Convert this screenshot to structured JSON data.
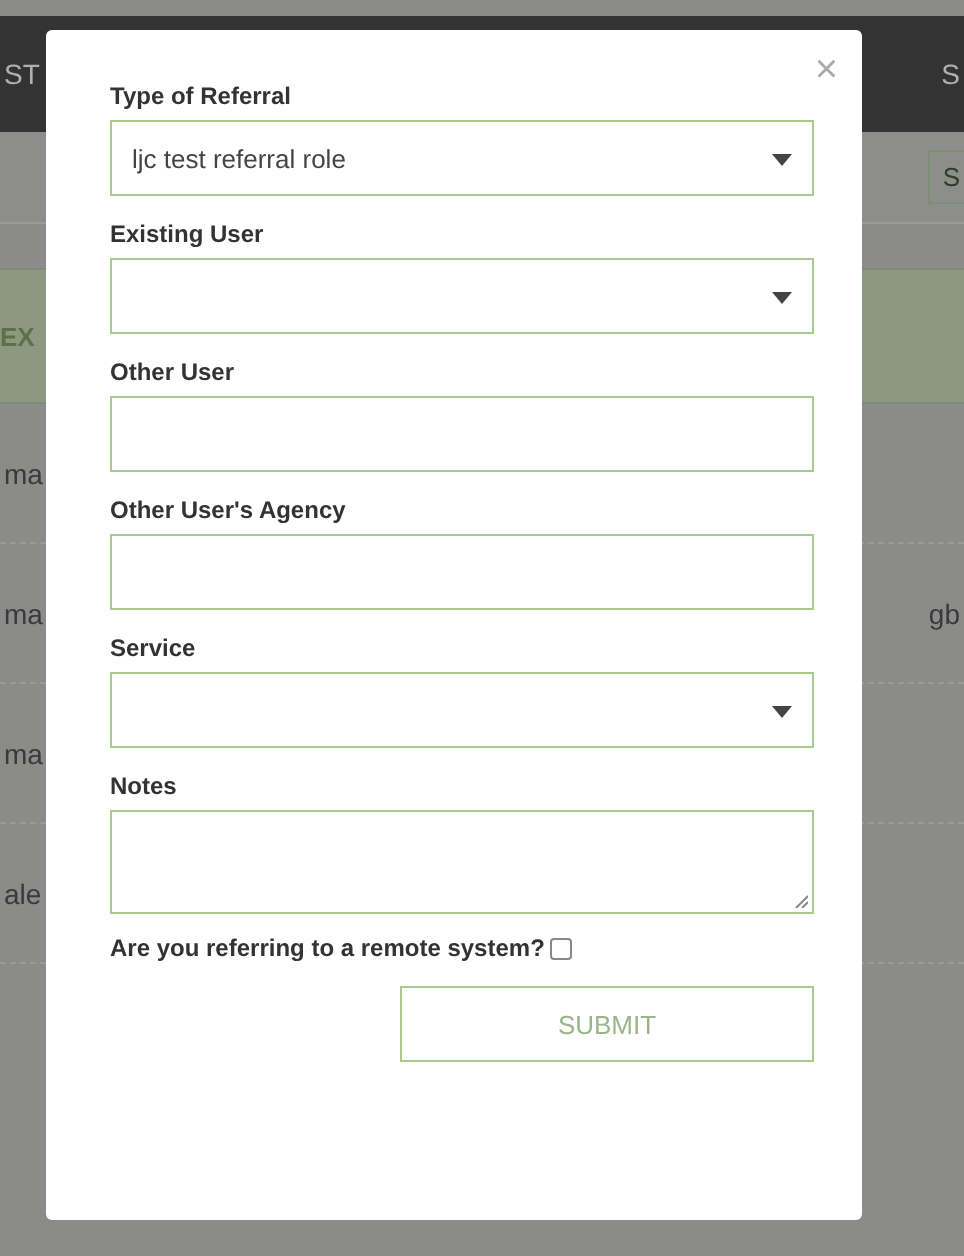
{
  "background": {
    "header_left": "ST",
    "header_right": "S",
    "toolbar_right": "S",
    "band_left": "EX",
    "rows": [
      {
        "left": "ma"
      },
      {
        "left": "ma",
        "right": "gb"
      },
      {
        "left": "ma"
      },
      {
        "left": "ale"
      }
    ]
  },
  "modal": {
    "close": "×",
    "fields": [
      {
        "kind": "select",
        "label": "Type of Referral",
        "value": "ljc test referral role"
      },
      {
        "kind": "select",
        "label": "Existing User"
      },
      {
        "kind": "text",
        "label": "Other User"
      },
      {
        "kind": "text",
        "label": "Other User's Agency"
      },
      {
        "kind": "select",
        "label": "Service"
      },
      {
        "kind": "textarea",
        "label": "Notes"
      }
    ],
    "remote": {
      "label": "Are you referring to a remote system?",
      "checked": false
    },
    "submit": "SUBMIT"
  }
}
